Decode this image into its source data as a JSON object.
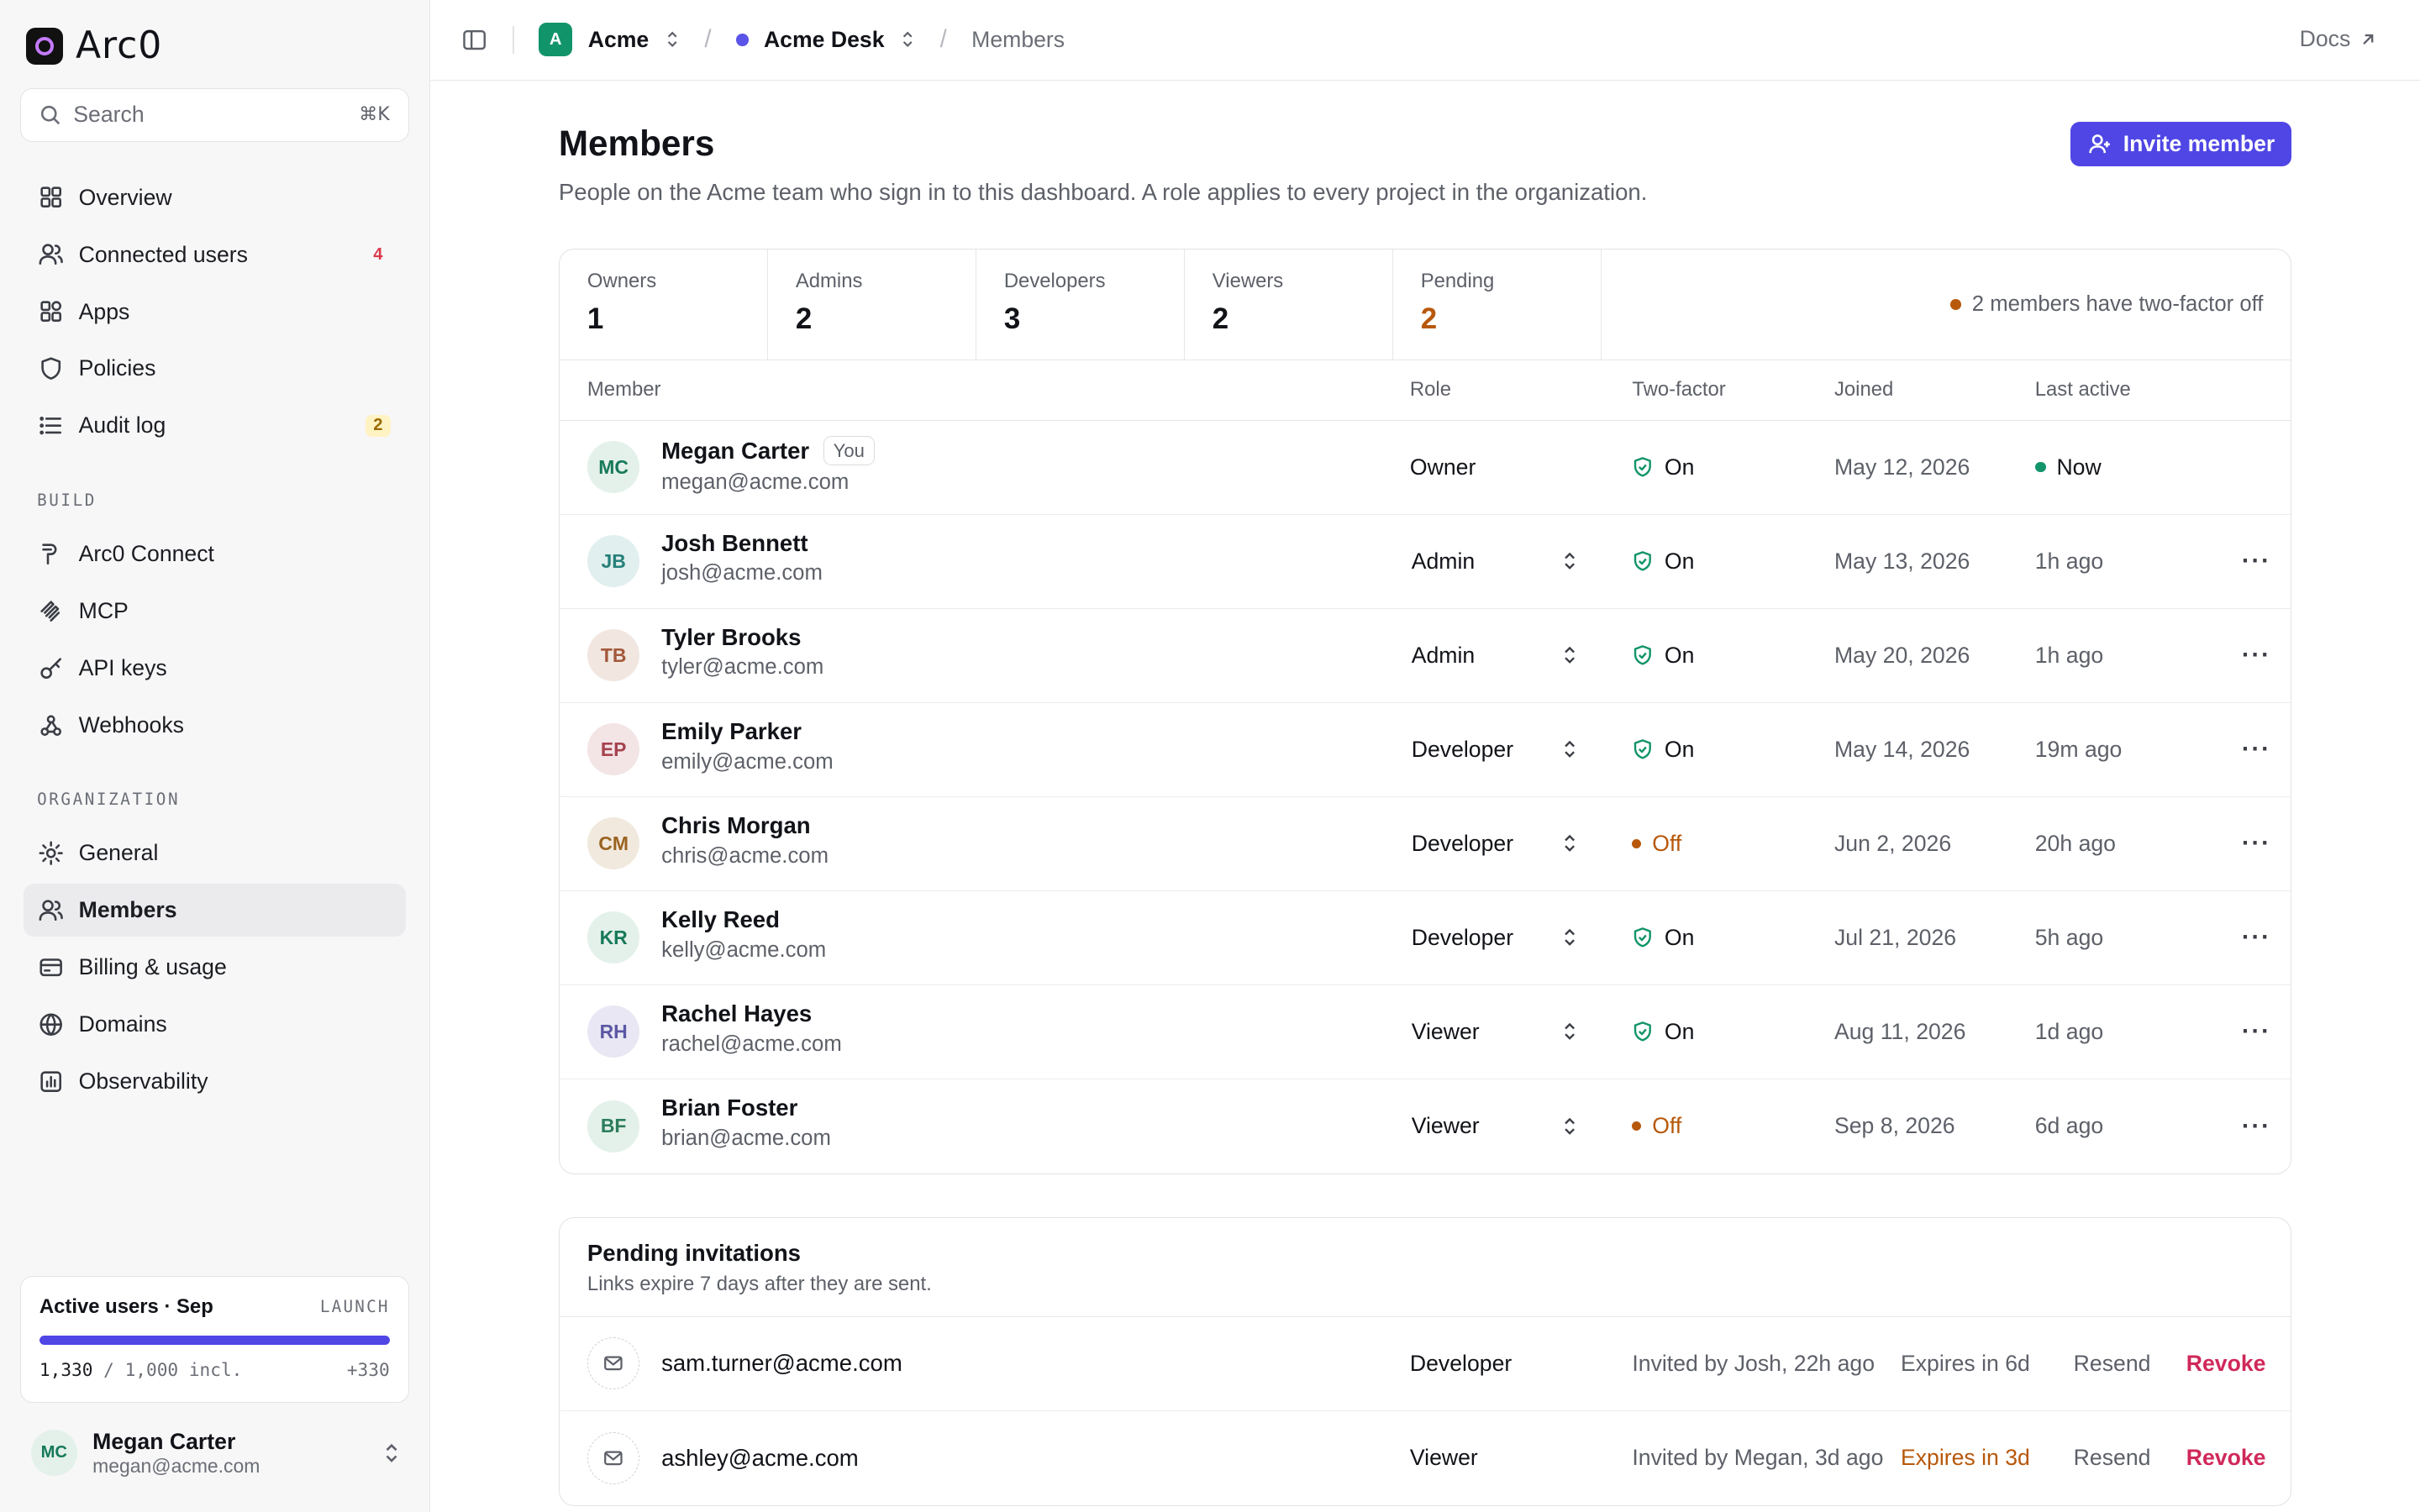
{
  "app": {
    "logo_text": "Arc0"
  },
  "search": {
    "placeholder": "Search",
    "shortcut": "⌘K"
  },
  "sidebar": {
    "main": [
      {
        "label": "Overview",
        "icon": "grid-icon"
      },
      {
        "label": "Connected users",
        "icon": "users-icon",
        "badge": "4"
      },
      {
        "label": "Apps",
        "icon": "apps-icon"
      },
      {
        "label": "Policies",
        "icon": "shield-icon"
      },
      {
        "label": "Audit log",
        "icon": "list-icon",
        "badge": "2"
      }
    ],
    "build_label": "BUILD",
    "build": [
      {
        "label": "Arc0 Connect",
        "icon": "plug-icon"
      },
      {
        "label": "MCP",
        "icon": "mcp-icon"
      },
      {
        "label": "API keys",
        "icon": "key-icon"
      },
      {
        "label": "Webhooks",
        "icon": "webhook-icon"
      }
    ],
    "org_label": "ORGANIZATION",
    "org": [
      {
        "label": "General",
        "icon": "gear-icon"
      },
      {
        "label": "Members",
        "icon": "members-icon",
        "active": true
      },
      {
        "label": "Billing & usage",
        "icon": "card-icon"
      },
      {
        "label": "Domains",
        "icon": "globe-icon"
      },
      {
        "label": "Observability",
        "icon": "chart-icon"
      }
    ],
    "usage": {
      "title": "Active users · Sep",
      "plan": "LAUNCH",
      "used": "1,330",
      "included": "/ 1,000 incl.",
      "overage": "+330",
      "fill_fraction": 1.0
    },
    "user": {
      "initials": "MC",
      "name": "Megan Carter",
      "email": "megan@acme.com"
    }
  },
  "topbar": {
    "org_initial": "A",
    "org": "Acme",
    "project": "Acme Desk",
    "page": "Members",
    "docs": "Docs"
  },
  "page": {
    "title": "Members",
    "description": "People on the Acme team who sign in to this dashboard. A role applies to every project in the organization.",
    "invite_label": "Invite member"
  },
  "stats": [
    {
      "label": "Owners",
      "value": "1"
    },
    {
      "label": "Admins",
      "value": "2"
    },
    {
      "label": "Developers",
      "value": "3"
    },
    {
      "label": "Viewers",
      "value": "2"
    },
    {
      "label": "Pending",
      "value": "2",
      "highlight": true
    }
  ],
  "stats_note": "2 members have two-factor off",
  "columns": {
    "member": "Member",
    "role": "Role",
    "two_factor": "Two-factor",
    "joined": "Joined",
    "last_active": "Last active"
  },
  "you_label": "You",
  "members": [
    {
      "initials": "MC",
      "name": "Megan Carter",
      "email": "megan@acme.com",
      "role": "Owner",
      "two_factor": "On",
      "joined": "May 12, 2026",
      "last_active": "Now",
      "you": true,
      "bg": "#e3f1ea",
      "fg": "#17795a"
    },
    {
      "initials": "JB",
      "name": "Josh Bennett",
      "email": "josh@acme.com",
      "role": "Admin",
      "two_factor": "On",
      "joined": "May 13, 2026",
      "last_active": "1h ago",
      "bg": "#e1efee",
      "fg": "#26807a"
    },
    {
      "initials": "TB",
      "name": "Tyler Brooks",
      "email": "tyler@acme.com",
      "role": "Admin",
      "two_factor": "On",
      "joined": "May 20, 2026",
      "last_active": "1h ago",
      "bg": "#f2e6e0",
      "fg": "#a2583a"
    },
    {
      "initials": "EP",
      "name": "Emily Parker",
      "email": "emily@acme.com",
      "role": "Developer",
      "two_factor": "On",
      "joined": "May 14, 2026",
      "last_active": "19m ago",
      "bg": "#f3e4e6",
      "fg": "#a5424f"
    },
    {
      "initials": "CM",
      "name": "Chris Morgan",
      "email": "chris@acme.com",
      "role": "Developer",
      "two_factor": "Off",
      "joined": "Jun 2, 2026",
      "last_active": "20h ago",
      "bg": "#f1e9de",
      "fg": "#9a6320"
    },
    {
      "initials": "KR",
      "name": "Kelly Reed",
      "email": "kelly@acme.com",
      "role": "Developer",
      "two_factor": "On",
      "joined": "Jul 21, 2026",
      "last_active": "5h ago",
      "bg": "#e3f1ea",
      "fg": "#17795a"
    },
    {
      "initials": "RH",
      "name": "Rachel Hayes",
      "email": "rachel@acme.com",
      "role": "Viewer",
      "two_factor": "On",
      "joined": "Aug 11, 2026",
      "last_active": "1d ago",
      "bg": "#e8e7f3",
      "fg": "#5a57a3"
    },
    {
      "initials": "BF",
      "name": "Brian Foster",
      "email": "brian@acme.com",
      "role": "Viewer",
      "two_factor": "Off",
      "joined": "Sep 8, 2026",
      "last_active": "6d ago",
      "bg": "#e3f1ea",
      "fg": "#2c7d5c"
    }
  ],
  "pending": {
    "title": "Pending invitations",
    "subtitle": "Links expire 7 days after they are sent.",
    "resend_label": "Resend",
    "revoke_label": "Revoke",
    "items": [
      {
        "email": "sam.turner@acme.com",
        "role": "Developer",
        "invited": "Invited by Josh, 22h ago",
        "expires": "Expires in 6d",
        "warn": false
      },
      {
        "email": "ashley@acme.com",
        "role": "Viewer",
        "invited": "Invited by Megan, 3d ago",
        "expires": "Expires in 3d",
        "warn": true
      }
    ]
  },
  "colors": {
    "accent": "#4f46e5",
    "green": "#12946a",
    "warning": "#b7580b",
    "danger": "#d0285a"
  }
}
